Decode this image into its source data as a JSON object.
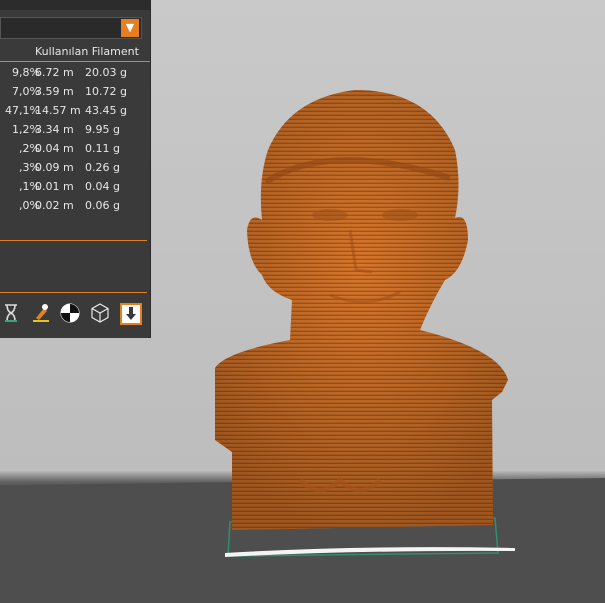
{
  "panel": {
    "header": "Kullanılan Filament",
    "rows": [
      {
        "pct": "9,8%",
        "length": "6.72 m",
        "weight": "20.03 g"
      },
      {
        "pct": "7,0%",
        "length": "3.59 m",
        "weight": "10.72 g"
      },
      {
        "pct": "47,1%",
        "length": "14.57 m",
        "weight": "43.45 g"
      },
      {
        "pct": "1,2%",
        "length": "3.34 m",
        "weight": "9.95 g"
      },
      {
        "pct": ",2%",
        "length": "0.04 m",
        "weight": "0.11 g"
      },
      {
        "pct": ",3%",
        "length": "0.09 m",
        "weight": "0.26 g"
      },
      {
        "pct": ",1%",
        "length": "0.01 m",
        "weight": "0.04 g"
      },
      {
        "pct": ",0%",
        "length": "0.02 m",
        "weight": "0.06 g"
      }
    ],
    "dropdown_arrow": "▼"
  },
  "toolbar": {
    "icons": [
      "hourglass-icon",
      "paint-brush-icon",
      "contrast-circle-icon",
      "cube-outline-icon",
      "download-arrow-icon"
    ]
  },
  "colors": {
    "accent": "#e67e22",
    "panel_bg": "#3a3a3a",
    "model": "#d9752a"
  }
}
